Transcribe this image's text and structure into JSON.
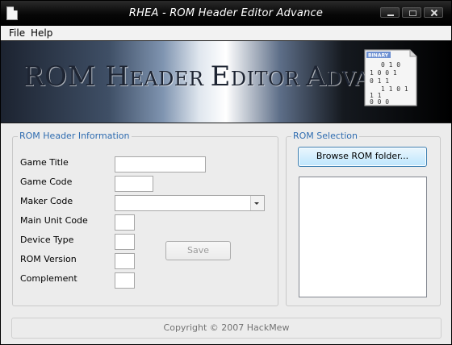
{
  "window": {
    "title": "RHEA - ROM Header Editor Advance"
  },
  "menu": {
    "file": "File",
    "help": "Help"
  },
  "banner": {
    "title_part1": "ROM H",
    "title_part2": "EADER ",
    "title_part3": "E",
    "title_part4": "DITOR ",
    "title_part5": "A",
    "title_part6": "DVANCE",
    "icon_label": "BINARY",
    "icon_rows": [
      "0 1 0",
      "1 0 0 1",
      "0 1 1",
      "1 1 0 1",
      "1 1",
      "0 0 0"
    ]
  },
  "header_info": {
    "title": "ROM Header Information",
    "fields": {
      "game_title": {
        "label": "Game Title",
        "value": ""
      },
      "game_code": {
        "label": "Game Code",
        "value": ""
      },
      "maker_code": {
        "label": "Maker Code",
        "value": ""
      },
      "main_unit_code": {
        "label": "Main Unit Code",
        "value": ""
      },
      "device_type": {
        "label": "Device Type",
        "value": ""
      },
      "rom_version": {
        "label": "ROM Version",
        "value": ""
      },
      "complement": {
        "label": "Complement",
        "value": ""
      }
    },
    "save_label": "Save"
  },
  "rom_selection": {
    "title": "ROM Selection",
    "browse_label": "Browse ROM folder...",
    "items": []
  },
  "status": {
    "copyright": "Copyright © 2007 HackMew"
  }
}
